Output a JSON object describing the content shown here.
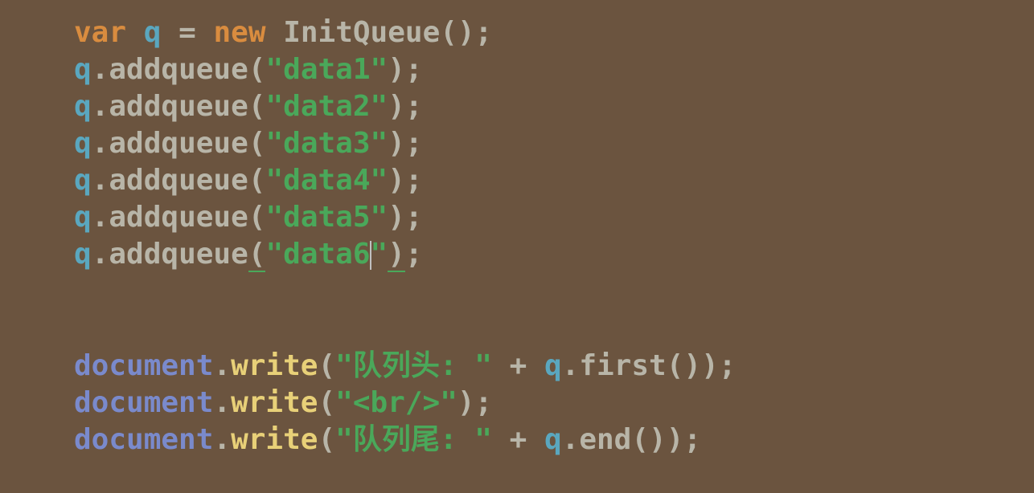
{
  "code": {
    "line1": {
      "kw_var": "var",
      "var_name": "q",
      "eq": "=",
      "kw_new": "new",
      "classname": "InitQueue",
      "open": "(",
      "close": ")",
      "semi": ";"
    },
    "addqueue_lines": [
      {
        "obj": "q",
        "dot": ".",
        "method": "addqueue",
        "open": "(",
        "q1": "\"",
        "val": "data1",
        "q2": "\"",
        "close": ")",
        "semi": ";"
      },
      {
        "obj": "q",
        "dot": ".",
        "method": "addqueue",
        "open": "(",
        "q1": "\"",
        "val": "data2",
        "q2": "\"",
        "close": ")",
        "semi": ";"
      },
      {
        "obj": "q",
        "dot": ".",
        "method": "addqueue",
        "open": "(",
        "q1": "\"",
        "val": "data3",
        "q2": "\"",
        "close": ")",
        "semi": ";"
      },
      {
        "obj": "q",
        "dot": ".",
        "method": "addqueue",
        "open": "(",
        "q1": "\"",
        "val": "data4",
        "q2": "\"",
        "close": ")",
        "semi": ";"
      },
      {
        "obj": "q",
        "dot": ".",
        "method": "addqueue",
        "open": "(",
        "q1": "\"",
        "val": "data5",
        "q2": "\"",
        "close": ")",
        "semi": ";"
      },
      {
        "obj": "q",
        "dot": ".",
        "method": "addqueue",
        "open": "(",
        "q1": "\"",
        "val": "data6",
        "q2": "\"",
        "close": ")",
        "semi": ";"
      }
    ],
    "write_first": {
      "doc": "document",
      "dot": ".",
      "write": "write",
      "open": "(",
      "q1": "\"",
      "str": "队列头: ",
      "q2": "\"",
      "plus": "+",
      "obj": "q",
      "dot2": ".",
      "method": "first",
      "open2": "(",
      "close2": ")",
      "close": ")",
      "semi": ";"
    },
    "write_br": {
      "doc": "document",
      "dot": ".",
      "write": "write",
      "open": "(",
      "q1": "\"",
      "str": "<br/>",
      "q2": "\"",
      "close": ")",
      "semi": ";"
    },
    "write_end": {
      "doc": "document",
      "dot": ".",
      "write": "write",
      "open": "(",
      "q1": "\"",
      "str": "队列尾: ",
      "q2": "\"",
      "plus": "+",
      "obj": "q",
      "dot2": ".",
      "method": "end",
      "open2": "(",
      "close2": ")",
      "close": ")",
      "semi": ";"
    }
  }
}
